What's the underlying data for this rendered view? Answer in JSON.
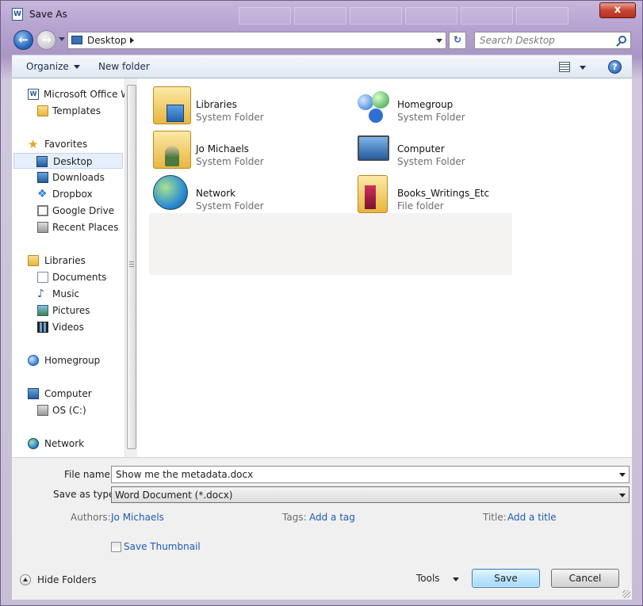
{
  "window": {
    "title": "Save As",
    "close_label": "x"
  },
  "address": {
    "location": "Desktop",
    "search_placeholder": "Search Desktop"
  },
  "toolbar": {
    "organize": "Organize",
    "new_folder": "New folder"
  },
  "nav": {
    "items": [
      {
        "label": "Microsoft Office W",
        "icon": "word-icon"
      },
      {
        "label": "Templates",
        "icon": "folder-icon"
      },
      {
        "label": "Favorites",
        "icon": "star-icon"
      },
      {
        "label": "Desktop",
        "icon": "desktop-icon",
        "selected": true
      },
      {
        "label": "Downloads",
        "icon": "downloads-icon"
      },
      {
        "label": "Dropbox",
        "icon": "dropbox-icon"
      },
      {
        "label": "Google Drive",
        "icon": "google-drive-icon"
      },
      {
        "label": "Recent Places",
        "icon": "recent-places-icon"
      },
      {
        "label": "Libraries",
        "icon": "libraries-icon"
      },
      {
        "label": "Documents",
        "icon": "documents-icon"
      },
      {
        "label": "Music",
        "icon": "music-icon"
      },
      {
        "label": "Pictures",
        "icon": "pictures-icon"
      },
      {
        "label": "Videos",
        "icon": "videos-icon"
      },
      {
        "label": "Homegroup",
        "icon": "homegroup-icon"
      },
      {
        "label": "Computer",
        "icon": "computer-icon"
      },
      {
        "label": "OS (C:)",
        "icon": "drive-icon"
      },
      {
        "label": "Network",
        "icon": "network-icon"
      }
    ]
  },
  "content": {
    "items": [
      {
        "name": "Libraries",
        "type": "System Folder",
        "icon": "libraries-icon"
      },
      {
        "name": "Homegroup",
        "type": "System Folder",
        "icon": "homegroup-icon"
      },
      {
        "name": "Jo Michaels",
        "type": "System Folder",
        "icon": "user-folder-icon"
      },
      {
        "name": "Computer",
        "type": "System Folder",
        "icon": "computer-icon"
      },
      {
        "name": "Network",
        "type": "System Folder",
        "icon": "network-icon"
      },
      {
        "name": "Books_Writings_Etc",
        "type": "File folder",
        "icon": "folder-icon"
      }
    ]
  },
  "form": {
    "file_name_label": "File name:",
    "file_name_value": "Show me the metadata.docx",
    "save_type_label": "Save as type:",
    "save_type_value": "Word Document (*.docx)",
    "authors_label": "Authors:",
    "authors_value": "Jo Michaels",
    "tags_label": "Tags:",
    "tags_value": "Add a tag",
    "title_label": "Title:",
    "title_value": "Add a title",
    "thumbnail_label": "Save Thumbnail",
    "hide_folders": "Hide Folders",
    "tools": "Tools",
    "save": "Save",
    "cancel": "Cancel"
  }
}
